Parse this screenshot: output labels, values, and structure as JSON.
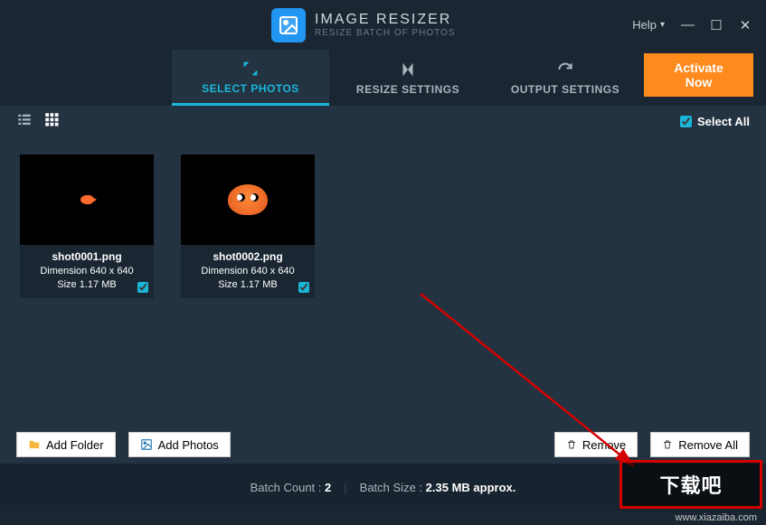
{
  "titlebar": {
    "app_title": "IMAGE RESIZER",
    "app_subtitle": "RESIZE BATCH OF PHOTOS",
    "help_label": "Help"
  },
  "tabs": {
    "select_photos": "SELECT PHOTOS",
    "resize_settings": "RESIZE SETTINGS",
    "output_settings": "OUTPUT SETTINGS",
    "activate_now": "Activate Now"
  },
  "toolbar": {
    "select_all_label": "Select All",
    "select_all_checked": true
  },
  "photos": [
    {
      "filename": "shot0001.png",
      "dimension_label": "Dimension 640 x 640",
      "size_label": "Size 1.17 MB",
      "checked": true
    },
    {
      "filename": "shot0002.png",
      "dimension_label": "Dimension 640 x 640",
      "size_label": "Size 1.17 MB",
      "checked": true
    }
  ],
  "actions": {
    "add_folder": "Add Folder",
    "add_photos": "Add Photos",
    "remove": "Remove",
    "remove_all": "Remove All"
  },
  "status": {
    "batch_count_label": "Batch Count :",
    "batch_count_value": "2",
    "batch_size_label": "Batch Size :",
    "batch_size_value": "2.35 MB approx."
  },
  "overlay": {
    "watermark_text": "下载吧",
    "watermark_url": "www.xiazaiba.com"
  }
}
